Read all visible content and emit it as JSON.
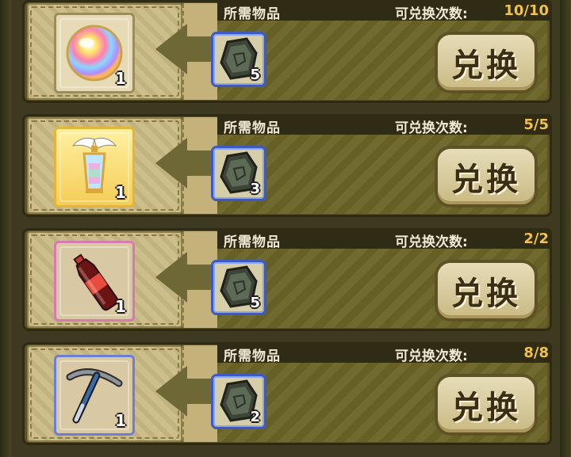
{
  "labels": {
    "required_items": "所需物品",
    "exchange_count": "可兑换次数:",
    "exchange_button": "兑换"
  },
  "rows": [
    {
      "reward": {
        "icon": "rainbow-orb-icon",
        "quantity": "1",
        "frame": "plain"
      },
      "cost": {
        "icon": "stone-tablet-icon",
        "quantity": "5"
      },
      "count": "10/10"
    },
    {
      "reward": {
        "icon": "winged-lantern-icon",
        "quantity": "1",
        "frame": "gold"
      },
      "cost": {
        "icon": "stone-tablet-icon",
        "quantity": "3"
      },
      "count": "5/5"
    },
    {
      "reward": {
        "icon": "cola-bottle-icon",
        "quantity": "1",
        "frame": "pink"
      },
      "cost": {
        "icon": "stone-tablet-icon",
        "quantity": "5"
      },
      "count": "2/2"
    },
    {
      "reward": {
        "icon": "pickaxe-icon",
        "quantity": "1",
        "frame": "blue"
      },
      "cost": {
        "icon": "stone-tablet-icon",
        "quantity": "2"
      },
      "count": "8/8"
    }
  ],
  "colors": {
    "count_value": "#f0c24a",
    "panel_dark": "#2f2b14",
    "panel_olive": "#6a6428"
  }
}
